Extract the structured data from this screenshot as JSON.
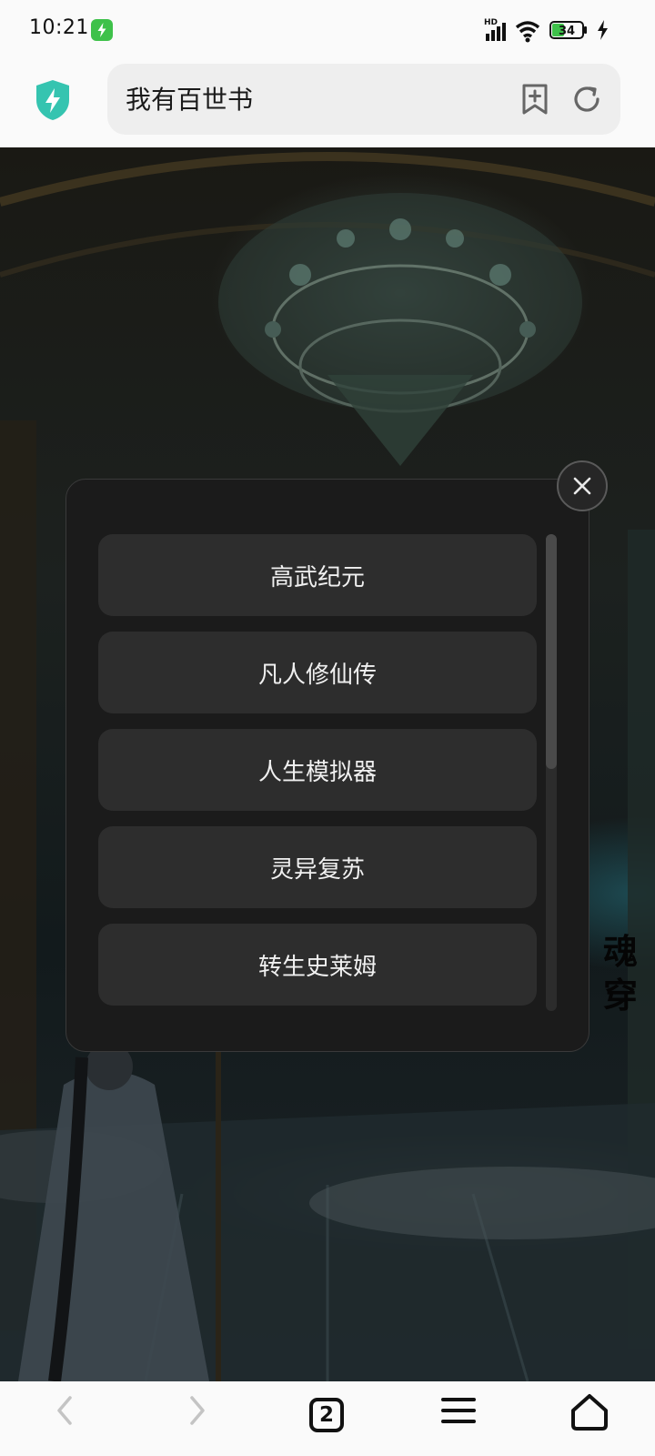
{
  "status_bar": {
    "time": "10:21",
    "network_badge": "HD",
    "battery": "34",
    "icons": [
      "charging-app-icon",
      "signal-icon",
      "wifi-icon",
      "battery-icon",
      "charging-bolt-icon"
    ]
  },
  "address_bar": {
    "query": "我有百世书",
    "icons": [
      "shield-bolt-icon",
      "bookmark-add-icon",
      "reload-icon"
    ]
  },
  "page": {
    "side_title": "魂穿"
  },
  "dialog": {
    "options": [
      "高武纪元",
      "凡人修仙传",
      "人生模拟器",
      "灵异复苏",
      "转生史莱姆"
    ],
    "scroll_position": 0.0,
    "close_icon": "close-icon"
  },
  "bottom_nav": {
    "tab_count": "2",
    "icons": [
      "back-icon",
      "forward-icon",
      "tabs-icon",
      "menu-icon",
      "home-icon"
    ]
  },
  "colors": {
    "accent": "#3ec14a",
    "shield": "#35c4b0",
    "dialog_bg": "#1b1b1b",
    "option_bg": "#2d2d2d"
  }
}
